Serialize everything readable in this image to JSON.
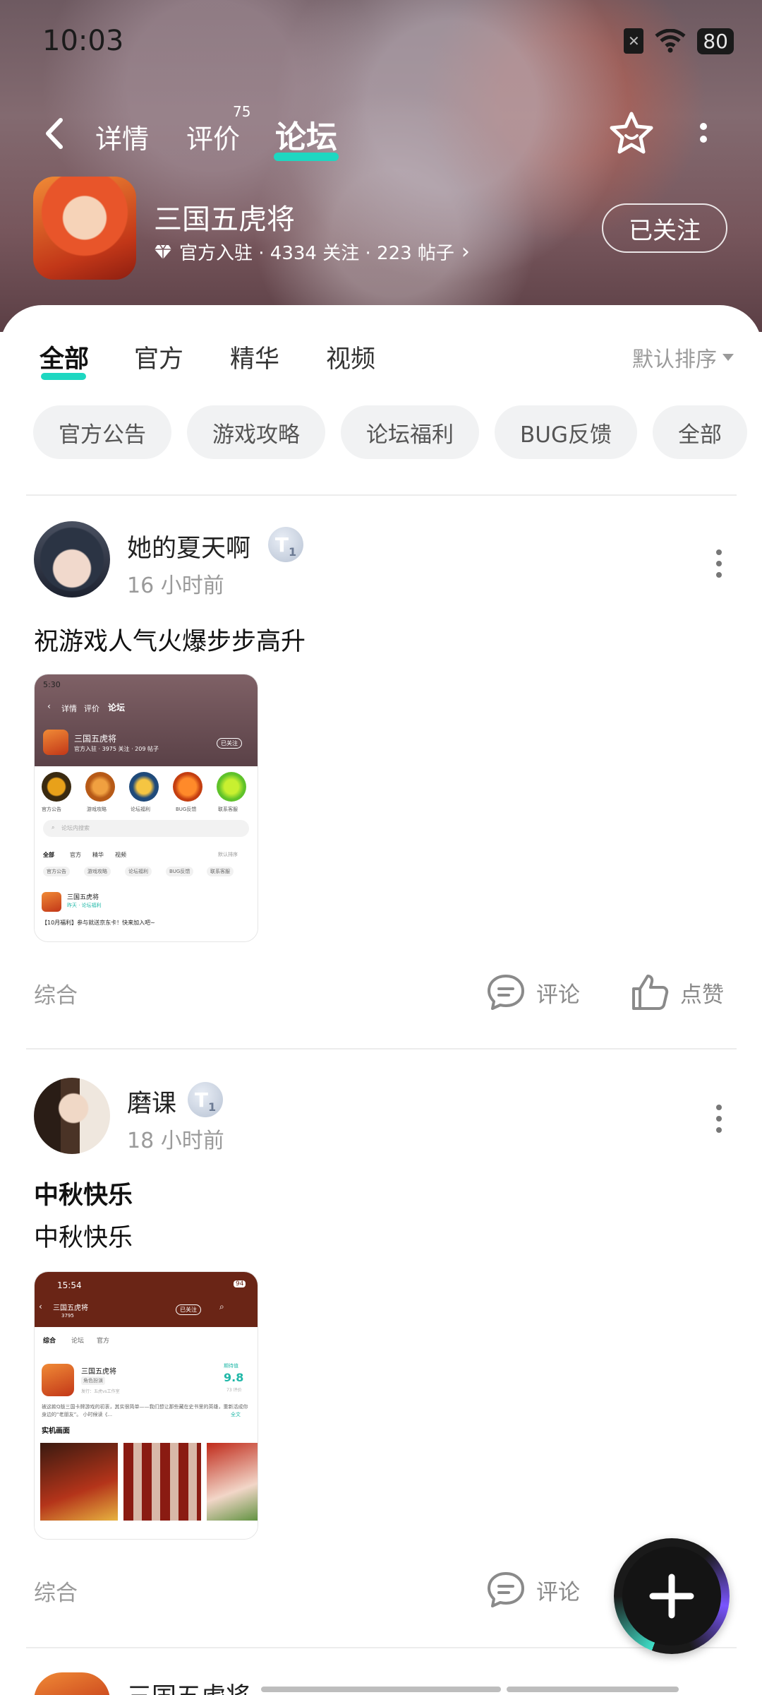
{
  "status_bar": {
    "time": "10:03",
    "battery": "80"
  },
  "nav": {
    "tabs": [
      {
        "label": "详情"
      },
      {
        "label": "评价",
        "count": "75"
      },
      {
        "label": "论坛"
      }
    ]
  },
  "app": {
    "name": "三国五虎将",
    "meta": "官方入驻 · 4334 关注 · 223 帖子",
    "follow_label": "已关注"
  },
  "filter_tabs": [
    "全部",
    "官方",
    "精华",
    "视频"
  ],
  "sort_label": "默认排序",
  "chips": [
    "官方公告",
    "游戏攻略",
    "论坛福利",
    "BUG反馈",
    "全部"
  ],
  "posts": [
    {
      "username": "她的夏天啊",
      "level": "T",
      "level_sub": "1",
      "time": "16 小时前",
      "title": "祝游戏人气火爆步步高升",
      "body": "",
      "tag": "综合",
      "comment_label": "评论",
      "like_label": "点赞",
      "thumb": {
        "time": "5:30",
        "tabs": [
          "详情",
          "评价",
          "论坛"
        ],
        "app_name": "三国五虎将",
        "app_meta": "官方入驻 · 3975 关注 · 209 帖子",
        "follow": "已关注",
        "icons": [
          "官方公告",
          "游戏攻略",
          "论坛福利",
          "BUG反馈",
          "联系客服"
        ],
        "search_placeholder": "论坛内搜索",
        "filters": [
          "全部",
          "官方",
          "精华",
          "视频"
        ],
        "sort": "默认排序",
        "chips": [
          "官方公告",
          "游戏攻略",
          "论坛福利",
          "BUG反馈",
          "联系客服"
        ],
        "post_name": "三国五虎将",
        "post_meta": "昨天 · 论坛福利",
        "post_title": "【10月福利】参与就送京东卡！快来加入吧~"
      }
    },
    {
      "username": "磨课",
      "level": "T",
      "level_sub": "1",
      "time": "18 小时前",
      "title": "中秋快乐",
      "body": "中秋快乐",
      "tag": "综合",
      "comment_label": "评论",
      "thumb": {
        "time": "15:54",
        "battery": "94",
        "app_name": "三国五虎将",
        "app_sub": "3795",
        "follow": "已关注",
        "tabs": [
          "综合",
          "论坛",
          "官方"
        ],
        "game_name": "三国五虎将",
        "game_tag": "角色扮演",
        "publisher": "发行：五虎vs工作室",
        "score_label": "期待值",
        "score": "9.8",
        "score_count": "73 评价",
        "desc": "被这款Q版三国卡牌游戏的初衷，其实很简单——我们想让那些藏在史书里的英雄，重新活成你身边的“老朋友”。 小时候读《...",
        "desc_more": "全文",
        "section": "实机画面"
      }
    }
  ],
  "peek_post": {
    "username": "三国五虎将"
  },
  "colors": {
    "accent": "#1ed7c1",
    "fab_ring_a": "#3fe0c9",
    "fab_ring_b": "#7a55ff"
  }
}
